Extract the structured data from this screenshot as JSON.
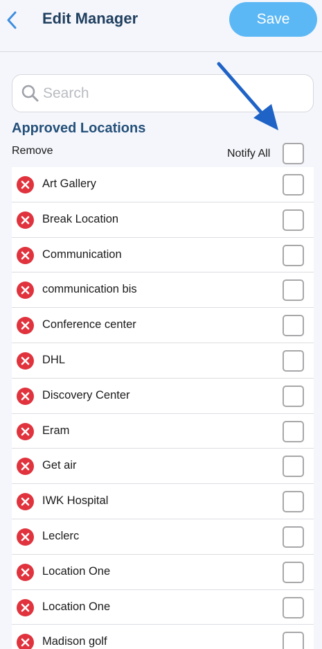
{
  "header": {
    "title": "Edit Manager",
    "save_label": "Save"
  },
  "search": {
    "placeholder": "Search",
    "value": ""
  },
  "section": {
    "title": "Approved Locations",
    "remove_label": "Remove",
    "notify_all_label": "Notify All",
    "notify_all_checked": false
  },
  "locations": [
    {
      "name": "Art Gallery",
      "notify": false
    },
    {
      "name": "Break Location",
      "notify": false
    },
    {
      "name": "Communication",
      "notify": false
    },
    {
      "name": "communication bis",
      "notify": false
    },
    {
      "name": "Conference center",
      "notify": false
    },
    {
      "name": "DHL",
      "notify": false
    },
    {
      "name": "Discovery Center",
      "notify": false
    },
    {
      "name": "Eram",
      "notify": false
    },
    {
      "name": "Get air",
      "notify": false
    },
    {
      "name": "IWK Hospital",
      "notify": false
    },
    {
      "name": "Leclerc",
      "notify": false
    },
    {
      "name": "Location One",
      "notify": false
    },
    {
      "name": "Location One",
      "notify": false
    },
    {
      "name": "Madison golf",
      "notify": false
    }
  ],
  "colors": {
    "accent": "#5cb8f5",
    "title": "#1f3f5f",
    "section_title": "#24507a",
    "remove_red": "#e0333d",
    "back_chevron": "#3d8ee0",
    "annotation_arrow": "#1f63c6"
  },
  "icons": {
    "back": "chevron-left-icon",
    "search": "magnifier-icon",
    "remove": "remove-circle-x-icon",
    "annotation": "arrow-annotation-icon"
  }
}
